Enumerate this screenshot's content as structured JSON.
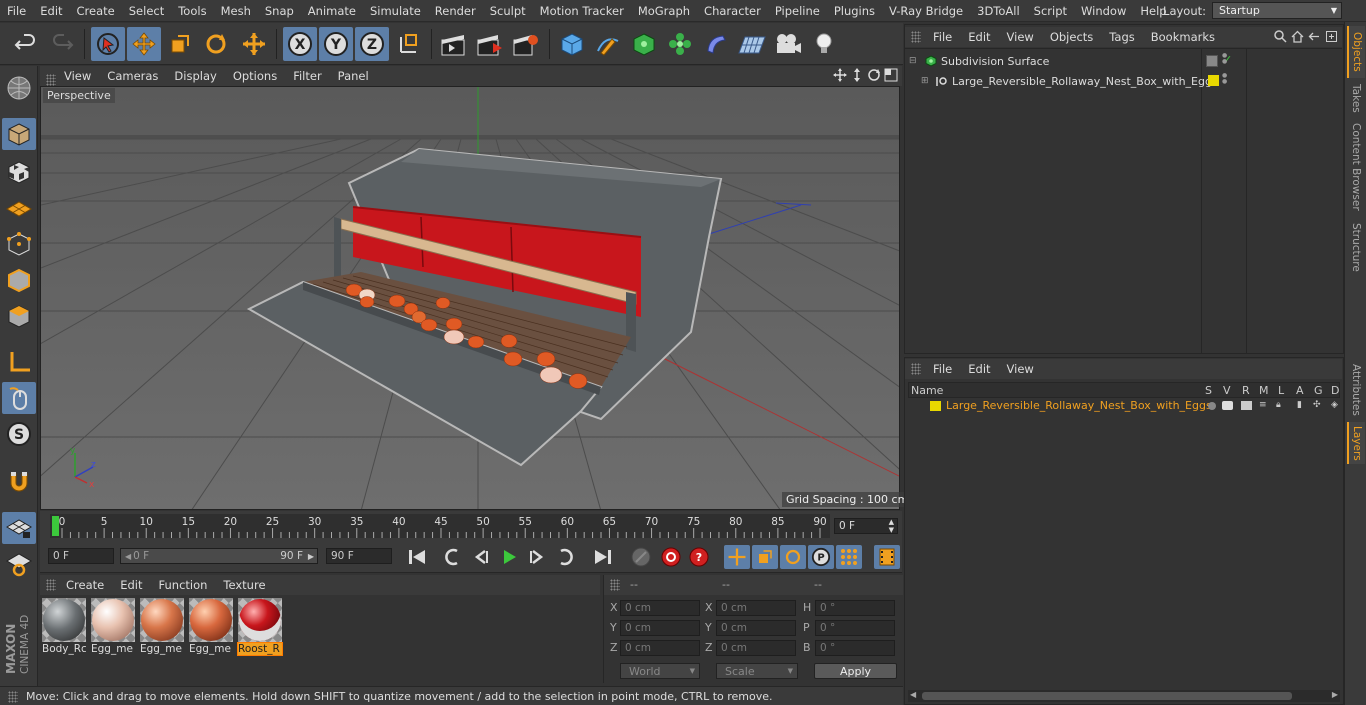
{
  "menubar": {
    "items": [
      "File",
      "Edit",
      "Create",
      "Select",
      "Tools",
      "Mesh",
      "Snap",
      "Animate",
      "Simulate",
      "Render",
      "Sculpt",
      "Motion Tracker",
      "MoGraph",
      "Character",
      "Pipeline",
      "Plugins",
      "V-Ray Bridge",
      "3DToAll",
      "Script",
      "Window",
      "Help"
    ],
    "layout_label": "Layout:",
    "layout_value": "Startup"
  },
  "viewport": {
    "menu": [
      "View",
      "Cameras",
      "Display",
      "Options",
      "Filter",
      "Panel"
    ],
    "camera_label": "Perspective",
    "grid_spacing": "Grid Spacing : 100 cm"
  },
  "timeline": {
    "ticks": [
      "0",
      "5",
      "10",
      "15",
      "20",
      "25",
      "30",
      "35",
      "40",
      "45",
      "50",
      "55",
      "60",
      "65",
      "70",
      "75",
      "80",
      "85",
      "90"
    ],
    "current_frame": "0 F",
    "start_field": "0 F",
    "range_start": "0 F",
    "range_end": "90 F",
    "end_field": "90 F"
  },
  "materials": {
    "menu": [
      "Create",
      "Edit",
      "Function",
      "Texture"
    ],
    "items": [
      {
        "label": "Body_Rc",
        "color": "#6a6f72"
      },
      {
        "label": "Egg_me",
        "color": "#e8c2b0"
      },
      {
        "label": "Egg_me",
        "color": "#d8764a"
      },
      {
        "label": "Egg_me",
        "color": "#d8683e"
      },
      {
        "label": "Roost_R",
        "color": "#c8161c"
      }
    ]
  },
  "coords": {
    "headers": [
      "--",
      "--",
      "--"
    ],
    "rows": [
      {
        "a": "X",
        "av": "0 cm",
        "b": "X",
        "bv": "0 cm",
        "c": "H",
        "cv": "0 °"
      },
      {
        "a": "Y",
        "av": "0 cm",
        "b": "Y",
        "bv": "0 cm",
        "c": "P",
        "cv": "0 °"
      },
      {
        "a": "Z",
        "av": "0 cm",
        "b": "Z",
        "bv": "0 cm",
        "c": "B",
        "cv": "0 °"
      }
    ],
    "mode1": "World",
    "mode2": "Scale",
    "apply": "Apply"
  },
  "status": "Move: Click and drag to move elements. Hold down SHIFT to quantize movement / add to the selection in point mode, CTRL to remove.",
  "object_manager": {
    "menu": [
      "File",
      "Edit",
      "View",
      "Objects",
      "Tags",
      "Bookmarks"
    ],
    "objects": [
      {
        "name": "Subdivision Surface"
      },
      {
        "name": "Large_Reversible_Rollaway_Nest_Box_with_Eggs"
      }
    ]
  },
  "layers": {
    "menu": [
      "File",
      "Edit",
      "View"
    ],
    "columns": [
      "Name",
      "S",
      "V",
      "R",
      "M",
      "L",
      "A",
      "G",
      "D"
    ],
    "row_name": "Large_Reversible_Rollaway_Nest_Box_with_Eggs",
    "row_color": "#e8d800"
  },
  "brand": {
    "line1": "MAXON",
    "line2": "CINEMA 4D"
  },
  "side_tabs": [
    "Objects",
    "Takes",
    "Content Browser",
    "Structure",
    "Attributes",
    "Layers"
  ]
}
